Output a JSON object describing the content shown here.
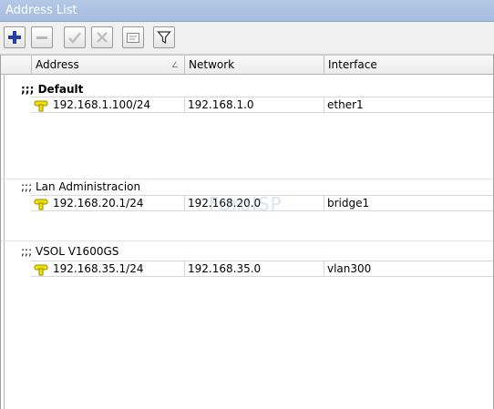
{
  "window": {
    "title": "Address List"
  },
  "toolbar": {
    "buttons": [
      {
        "name": "add-button",
        "icon": "plus-icon",
        "color": "#1f3fa8"
      },
      {
        "name": "remove-button",
        "icon": "minus-icon",
        "color": "#b0b0b0"
      },
      {
        "name": "enable-button",
        "icon": "check-icon",
        "color": "#b0b0b0"
      },
      {
        "name": "disable-button",
        "icon": "x-icon",
        "color": "#b0b0b0"
      },
      {
        "name": "comment-button",
        "icon": "note-icon",
        "color": "#909090"
      },
      {
        "name": "filter-button",
        "icon": "funnel-icon",
        "color": "#3a3a3a"
      }
    ]
  },
  "table": {
    "columns": [
      "Address",
      "Network",
      "Interface"
    ],
    "sort_indicator": "∠",
    "groups": [
      {
        "comment": ";;; Default",
        "bold": true,
        "row": {
          "address": "192.168.1.100/24",
          "network": "192.168.1.0",
          "interface": "ether1"
        }
      },
      {
        "comment": ";;; Lan Administracion",
        "bold": false,
        "row": {
          "address": "192.168.20.1/24",
          "network": "192.168.20.0",
          "interface": "bridge1"
        }
      },
      {
        "comment": ";;; VSOL V1600GS",
        "bold": false,
        "row": {
          "address": "192.168.35.1/24",
          "network": "192.168.35.0",
          "interface": "vlan300"
        }
      }
    ]
  },
  "watermark": "ForoISP"
}
